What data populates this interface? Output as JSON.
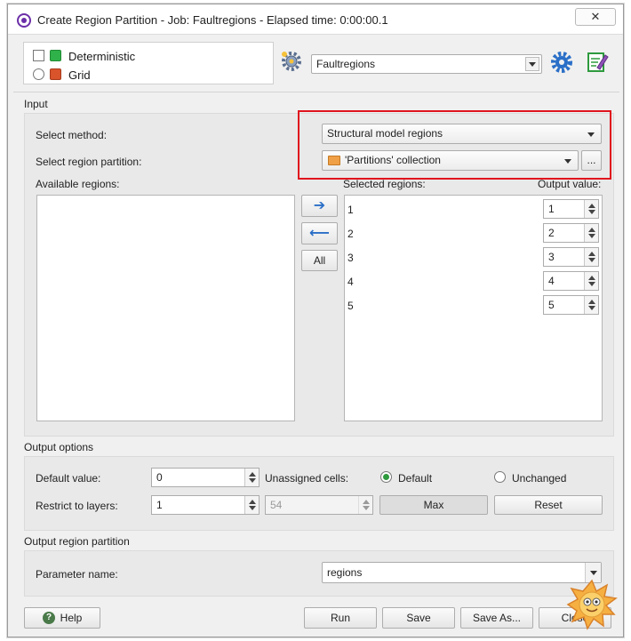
{
  "window": {
    "title": "Create Region Partition - Job: Faultregions - Elapsed time: 0:00:00.1",
    "close_glyph": "✕"
  },
  "top": {
    "deterministic_label": "Deterministic",
    "grid_label": "Grid",
    "job_name": "Faultregions"
  },
  "input": {
    "section_label": "Input",
    "select_method_label": "Select method:",
    "select_method_value": "Structural model regions",
    "select_partition_label": "Select region partition:",
    "select_partition_value": "'Partitions' collection",
    "browse_label": "...",
    "available_label": "Available regions:",
    "selected_label": "Selected regions:",
    "output_value_label": "Output value:",
    "move_right_glyph": "➔",
    "move_left_glyph": "⟵",
    "all_label": "All",
    "selected_regions": [
      {
        "name": "1",
        "value": "1"
      },
      {
        "name": "2",
        "value": "2"
      },
      {
        "name": "3",
        "value": "3"
      },
      {
        "name": "4",
        "value": "4"
      },
      {
        "name": "5",
        "value": "5"
      }
    ]
  },
  "output_options": {
    "section_label": "Output options",
    "default_value_label": "Default value:",
    "default_value": "0",
    "unassigned_label": "Unassigned cells:",
    "radio_default": "Default",
    "radio_unchanged": "Unchanged",
    "restrict_label": "Restrict to layers:",
    "restrict_from": "1",
    "restrict_to": "54",
    "max_label": "Max",
    "reset_label": "Reset"
  },
  "output_partition": {
    "section_label": "Output region partition",
    "param_label": "Parameter name:",
    "param_value": "regions"
  },
  "footer": {
    "help_label": "Help",
    "run_label": "Run",
    "save_label": "Save",
    "save_as_label": "Save As...",
    "close_label": "Close"
  },
  "colors": {
    "highlight": "#e0141e",
    "deterministic_cube": "#2fb24a",
    "grid_cube": "#d9532b",
    "arrow_blue": "#2a6fc7",
    "gear_blue": "#2a6fc7"
  },
  "icons": [
    "app-icon",
    "gear-settings-icon",
    "gear-blue-icon",
    "edit-notes-icon",
    "folder-icon",
    "help-icon"
  ]
}
